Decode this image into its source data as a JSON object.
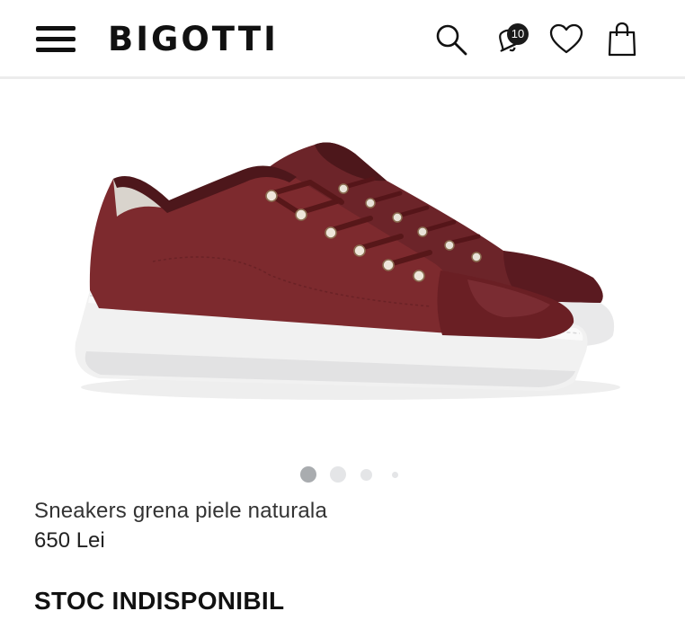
{
  "header": {
    "brand": "BIGOTTI",
    "icons": [
      "menu-icon",
      "search-icon",
      "notification-bell-icon",
      "heart-icon",
      "shopping-bag-icon"
    ],
    "notifications_count": "10"
  },
  "product": {
    "image": "burgundy-suede-sneaker",
    "name": "Sneakers grena piele naturala",
    "price": "650 Lei",
    "stock_status": "STOC INDISPONIBIL"
  },
  "carousel": {
    "slides": 4,
    "active_index": 0
  },
  "colors": {
    "suede": "#7d2a2e",
    "leather": "#6a1f24",
    "sole": "#f1f1f1",
    "dot_active": "#a9acaf",
    "dot_inactive": "#e4e5e7"
  }
}
